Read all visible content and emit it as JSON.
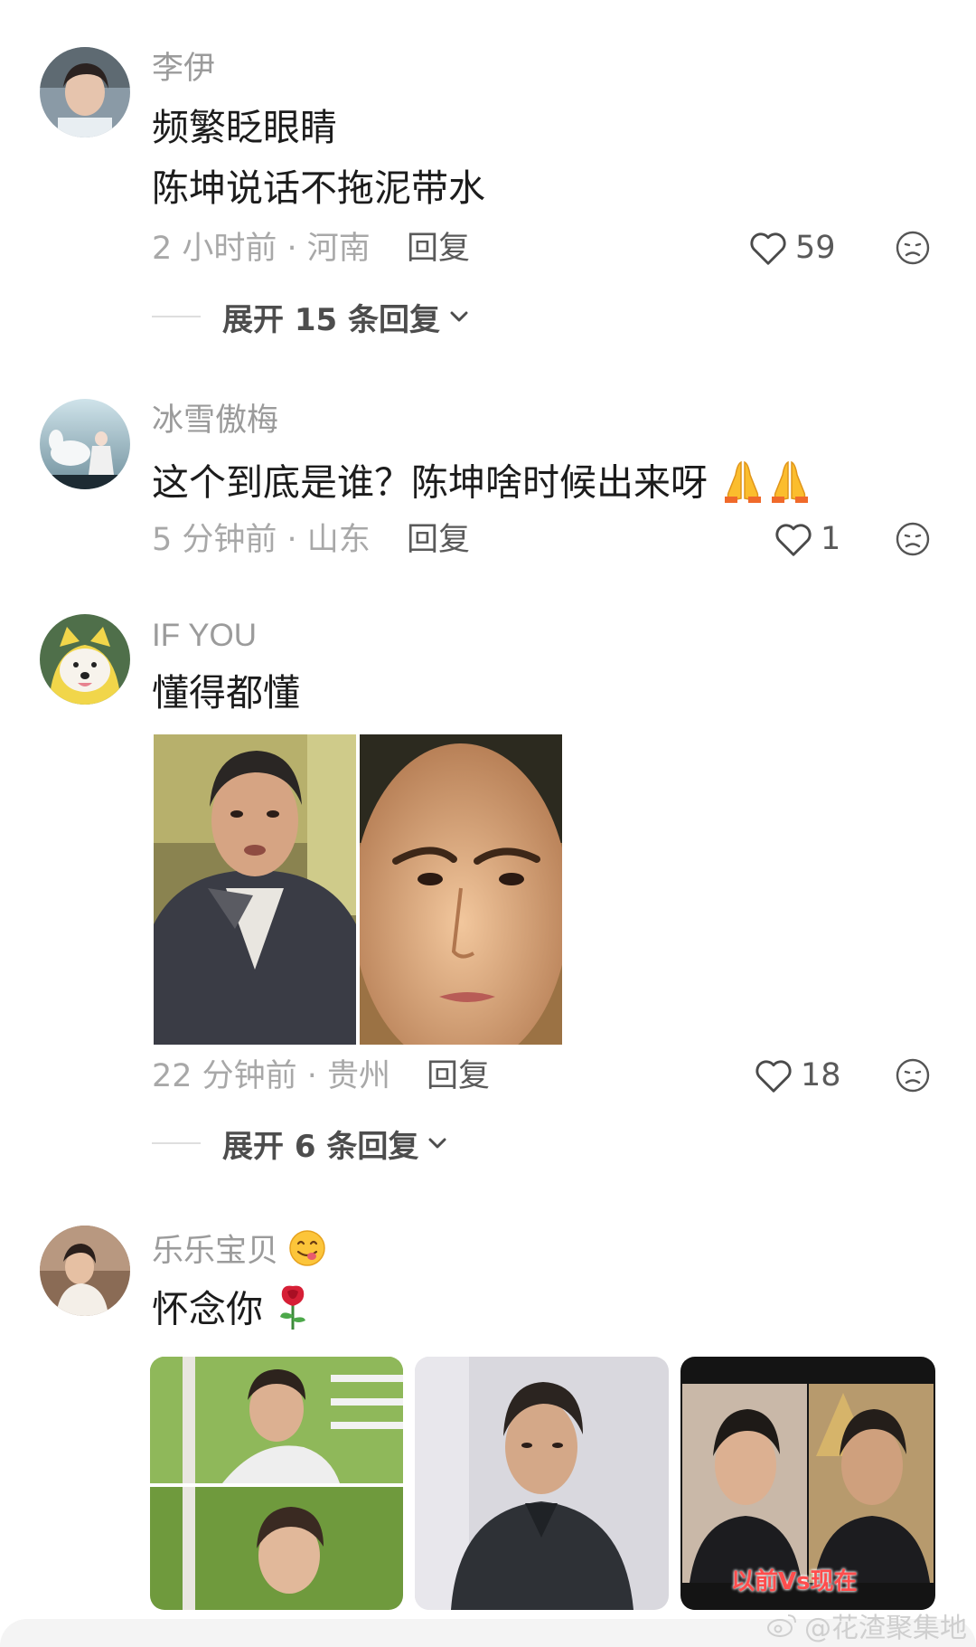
{
  "colors": {
    "meta": "#a8a8a8",
    "username": "#9b9b9b",
    "text": "#1c1c1c"
  },
  "comments": [
    {
      "username": "李伊",
      "lines": [
        "频繁眨眼睛",
        "陈坤说话不拖泥带水"
      ],
      "time_location": "2 小时前 · 河南",
      "reply_label": "回复",
      "likes": "59",
      "expand_label": "展开 15 条回复"
    },
    {
      "username": "冰雪傲梅",
      "lines": [
        "这个到底是谁？陈坤啥时候出来呀"
      ],
      "time_location": "5 分钟前 · 山东",
      "reply_label": "回复",
      "likes": "1"
    },
    {
      "username": "IF YOU",
      "lines": [
        "懂得都懂"
      ],
      "time_location": "22 分钟前 · 贵州",
      "reply_label": "回复",
      "likes": "18",
      "expand_label": "展开 6 条回复"
    },
    {
      "username": "乐乐宝贝",
      "lines": [
        "怀念你"
      ],
      "thumb3_caption": "以前Vs现在"
    }
  ],
  "icons": {
    "like": "heart-outline-icon",
    "dislike": "sad-face-icon",
    "expand": "chevron-down-icon",
    "pray": "folded-hands-emoji",
    "yum": "yum-face-emoji",
    "rose": "rose-emoji"
  },
  "watermark": "@花渣聚集地"
}
